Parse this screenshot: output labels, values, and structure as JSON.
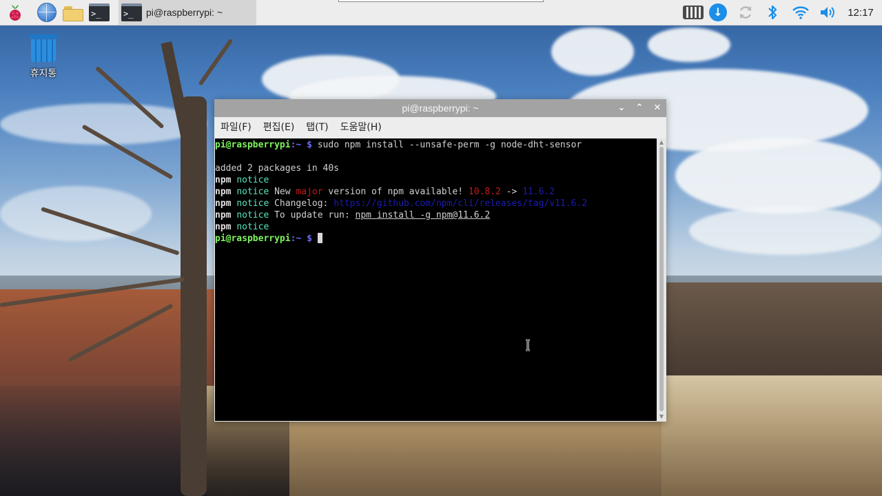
{
  "taskbar": {
    "launchers": [
      {
        "icon": "raspberry-pi-menu-icon"
      },
      {
        "icon": "web-browser-icon"
      },
      {
        "icon": "file-manager-icon"
      },
      {
        "icon": "terminal-icon"
      }
    ],
    "terminal_glyph": ">_",
    "task_label": "pi@raspberrypi: ~",
    "tray": [
      "virtual-keyboard-icon",
      "updates-icon",
      "network-sync-icon",
      "bluetooth-icon",
      "wifi-icon",
      "volume-icon"
    ],
    "clock": "12:17"
  },
  "desktop": {
    "icons": [
      {
        "label": "휴지통",
        "icon": "trash-icon"
      }
    ]
  },
  "terminal_window": {
    "title": "pi@raspberrypi: ~",
    "controls": {
      "minimize": "⌄",
      "maximize": "⌃",
      "close": "✕"
    },
    "menu": [
      "파일(F)",
      "편집(E)",
      "탭(T)",
      "도움말(H)"
    ],
    "prompt": {
      "userhost": "pi@raspberrypi",
      "path": ":~",
      "symbol": "$"
    },
    "command": "sudo npm install --unsafe-perm -g node-dht-sensor",
    "output": {
      "added": "added 2 packages in 40s",
      "npm": "npm",
      "notice": "notice",
      "new_prefix": "New ",
      "major": "major",
      "new_mid": " version of npm available! ",
      "old_version": "10.8.2",
      "arrow": " -> ",
      "new_version": "11.6.2",
      "changelog_prefix": "Changelog: ",
      "changelog_url": "https://github.com/npm/cli/releases/tag/v11.6.2",
      "update_prefix": "To update run: ",
      "update_cmd": "npm install -g npm@11.6.2"
    }
  },
  "colors": {
    "prompt_green": "#7ef55e",
    "prompt_blue": "#6b6bff",
    "notice_cyan": "#58e6c0",
    "major_red": "#c41a1a",
    "link_blue": "#1c1cb0"
  }
}
